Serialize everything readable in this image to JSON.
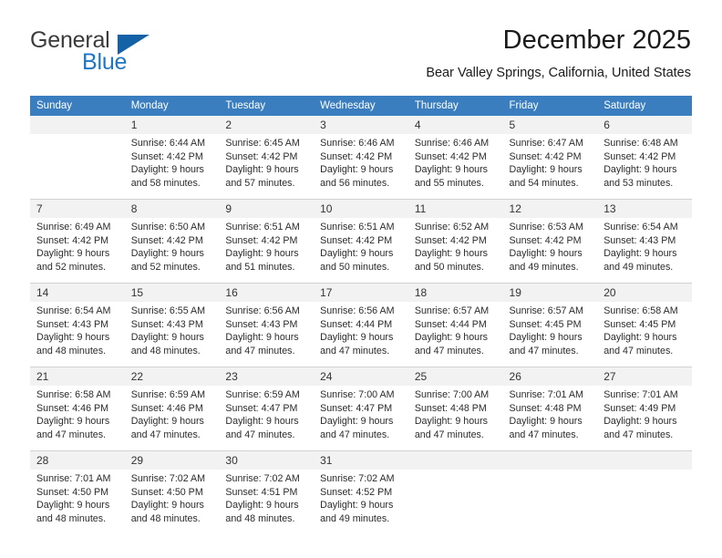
{
  "brand": {
    "name_part1": "General",
    "name_part2": "Blue",
    "triangle_color": "#1362a8",
    "blue_color": "#1f77c4"
  },
  "header": {
    "title": "December 2025",
    "subtitle": "Bear Valley Springs, California, United States"
  },
  "theme": {
    "header_row_bg": "#3b7ebf",
    "daynum_row_bg": "#f2f2f2",
    "grid_line": "#d2d2d2",
    "page_bg": "#ffffff"
  },
  "weekday_headers": [
    "Sunday",
    "Monday",
    "Tuesday",
    "Wednesday",
    "Thursday",
    "Friday",
    "Saturday"
  ],
  "weeks": [
    {
      "days": [
        {
          "num": "",
          "lines": []
        },
        {
          "num": "1",
          "lines": [
            "Sunrise: 6:44 AM",
            "Sunset: 4:42 PM",
            "Daylight: 9 hours",
            "and 58 minutes."
          ]
        },
        {
          "num": "2",
          "lines": [
            "Sunrise: 6:45 AM",
            "Sunset: 4:42 PM",
            "Daylight: 9 hours",
            "and 57 minutes."
          ]
        },
        {
          "num": "3",
          "lines": [
            "Sunrise: 6:46 AM",
            "Sunset: 4:42 PM",
            "Daylight: 9 hours",
            "and 56 minutes."
          ]
        },
        {
          "num": "4",
          "lines": [
            "Sunrise: 6:46 AM",
            "Sunset: 4:42 PM",
            "Daylight: 9 hours",
            "and 55 minutes."
          ]
        },
        {
          "num": "5",
          "lines": [
            "Sunrise: 6:47 AM",
            "Sunset: 4:42 PM",
            "Daylight: 9 hours",
            "and 54 minutes."
          ]
        },
        {
          "num": "6",
          "lines": [
            "Sunrise: 6:48 AM",
            "Sunset: 4:42 PM",
            "Daylight: 9 hours",
            "and 53 minutes."
          ]
        }
      ]
    },
    {
      "days": [
        {
          "num": "7",
          "lines": [
            "Sunrise: 6:49 AM",
            "Sunset: 4:42 PM",
            "Daylight: 9 hours",
            "and 52 minutes."
          ]
        },
        {
          "num": "8",
          "lines": [
            "Sunrise: 6:50 AM",
            "Sunset: 4:42 PM",
            "Daylight: 9 hours",
            "and 52 minutes."
          ]
        },
        {
          "num": "9",
          "lines": [
            "Sunrise: 6:51 AM",
            "Sunset: 4:42 PM",
            "Daylight: 9 hours",
            "and 51 minutes."
          ]
        },
        {
          "num": "10",
          "lines": [
            "Sunrise: 6:51 AM",
            "Sunset: 4:42 PM",
            "Daylight: 9 hours",
            "and 50 minutes."
          ]
        },
        {
          "num": "11",
          "lines": [
            "Sunrise: 6:52 AM",
            "Sunset: 4:42 PM",
            "Daylight: 9 hours",
            "and 50 minutes."
          ]
        },
        {
          "num": "12",
          "lines": [
            "Sunrise: 6:53 AM",
            "Sunset: 4:42 PM",
            "Daylight: 9 hours",
            "and 49 minutes."
          ]
        },
        {
          "num": "13",
          "lines": [
            "Sunrise: 6:54 AM",
            "Sunset: 4:43 PM",
            "Daylight: 9 hours",
            "and 49 minutes."
          ]
        }
      ]
    },
    {
      "days": [
        {
          "num": "14",
          "lines": [
            "Sunrise: 6:54 AM",
            "Sunset: 4:43 PM",
            "Daylight: 9 hours",
            "and 48 minutes."
          ]
        },
        {
          "num": "15",
          "lines": [
            "Sunrise: 6:55 AM",
            "Sunset: 4:43 PM",
            "Daylight: 9 hours",
            "and 48 minutes."
          ]
        },
        {
          "num": "16",
          "lines": [
            "Sunrise: 6:56 AM",
            "Sunset: 4:43 PM",
            "Daylight: 9 hours",
            "and 47 minutes."
          ]
        },
        {
          "num": "17",
          "lines": [
            "Sunrise: 6:56 AM",
            "Sunset: 4:44 PM",
            "Daylight: 9 hours",
            "and 47 minutes."
          ]
        },
        {
          "num": "18",
          "lines": [
            "Sunrise: 6:57 AM",
            "Sunset: 4:44 PM",
            "Daylight: 9 hours",
            "and 47 minutes."
          ]
        },
        {
          "num": "19",
          "lines": [
            "Sunrise: 6:57 AM",
            "Sunset: 4:45 PM",
            "Daylight: 9 hours",
            "and 47 minutes."
          ]
        },
        {
          "num": "20",
          "lines": [
            "Sunrise: 6:58 AM",
            "Sunset: 4:45 PM",
            "Daylight: 9 hours",
            "and 47 minutes."
          ]
        }
      ]
    },
    {
      "days": [
        {
          "num": "21",
          "lines": [
            "Sunrise: 6:58 AM",
            "Sunset: 4:46 PM",
            "Daylight: 9 hours",
            "and 47 minutes."
          ]
        },
        {
          "num": "22",
          "lines": [
            "Sunrise: 6:59 AM",
            "Sunset: 4:46 PM",
            "Daylight: 9 hours",
            "and 47 minutes."
          ]
        },
        {
          "num": "23",
          "lines": [
            "Sunrise: 6:59 AM",
            "Sunset: 4:47 PM",
            "Daylight: 9 hours",
            "and 47 minutes."
          ]
        },
        {
          "num": "24",
          "lines": [
            "Sunrise: 7:00 AM",
            "Sunset: 4:47 PM",
            "Daylight: 9 hours",
            "and 47 minutes."
          ]
        },
        {
          "num": "25",
          "lines": [
            "Sunrise: 7:00 AM",
            "Sunset: 4:48 PM",
            "Daylight: 9 hours",
            "and 47 minutes."
          ]
        },
        {
          "num": "26",
          "lines": [
            "Sunrise: 7:01 AM",
            "Sunset: 4:48 PM",
            "Daylight: 9 hours",
            "and 47 minutes."
          ]
        },
        {
          "num": "27",
          "lines": [
            "Sunrise: 7:01 AM",
            "Sunset: 4:49 PM",
            "Daylight: 9 hours",
            "and 47 minutes."
          ]
        }
      ]
    },
    {
      "days": [
        {
          "num": "28",
          "lines": [
            "Sunrise: 7:01 AM",
            "Sunset: 4:50 PM",
            "Daylight: 9 hours",
            "and 48 minutes."
          ]
        },
        {
          "num": "29",
          "lines": [
            "Sunrise: 7:02 AM",
            "Sunset: 4:50 PM",
            "Daylight: 9 hours",
            "and 48 minutes."
          ]
        },
        {
          "num": "30",
          "lines": [
            "Sunrise: 7:02 AM",
            "Sunset: 4:51 PM",
            "Daylight: 9 hours",
            "and 48 minutes."
          ]
        },
        {
          "num": "31",
          "lines": [
            "Sunrise: 7:02 AM",
            "Sunset: 4:52 PM",
            "Daylight: 9 hours",
            "and 49 minutes."
          ]
        },
        {
          "num": "",
          "lines": []
        },
        {
          "num": "",
          "lines": []
        },
        {
          "num": "",
          "lines": []
        }
      ]
    }
  ]
}
